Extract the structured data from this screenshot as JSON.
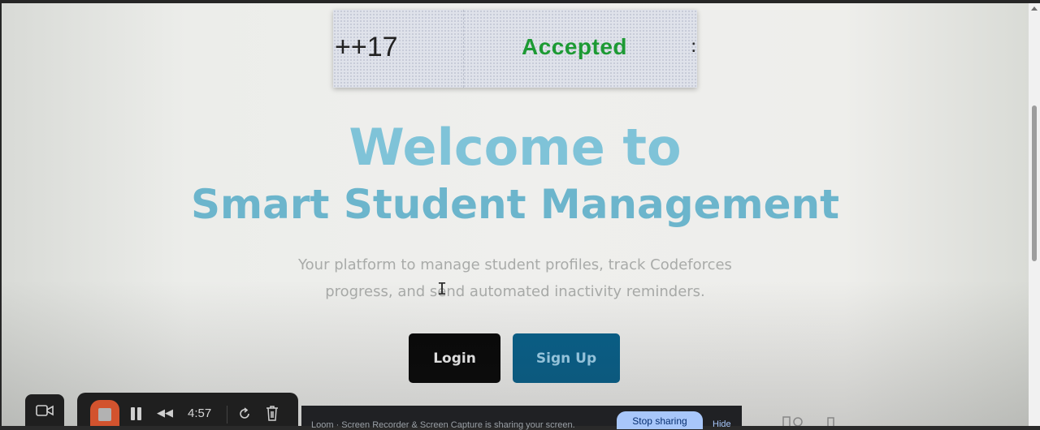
{
  "verdict_banner": {
    "language": "++17",
    "status": "Accepted",
    "more": ":",
    "status_color": "#1d9a34"
  },
  "hero": {
    "title_line1": "Welcome to",
    "title_line2": "Smart Student Management",
    "subtitle": "Your platform to manage student profiles, track Codeforces progress, and send automated inactivity reminders."
  },
  "actions": {
    "login_label": "Login",
    "signup_label": "Sign Up"
  },
  "recorder": {
    "elapsed": "4:57",
    "icons": [
      "camera-icon",
      "stop-icon",
      "pause-icon",
      "rewind-icon",
      "restart-icon",
      "trash-icon"
    ]
  },
  "share_bar": {
    "notice": "Loom · Screen Recorder & Screen Capture is sharing your screen.",
    "stop_label": "Stop sharing",
    "hide_label": "Hide"
  },
  "colors": {
    "title": "#7fc3d8",
    "signup_bg": "#08608a",
    "login_bg": "#080808",
    "record_stop": "#d2532e"
  }
}
